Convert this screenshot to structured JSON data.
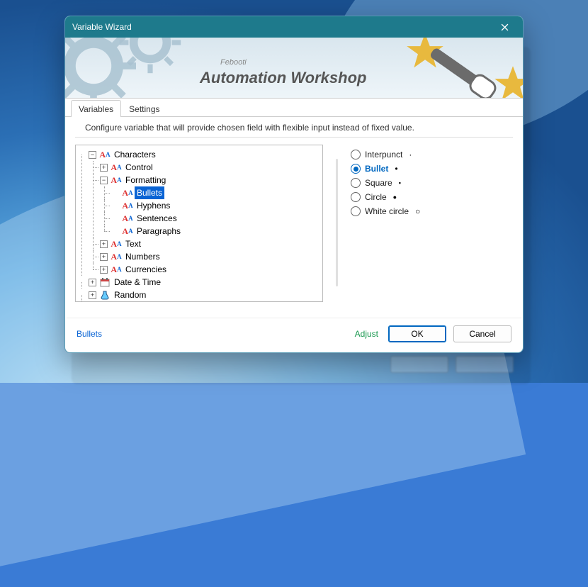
{
  "window": {
    "title": "Variable Wizard"
  },
  "banner": {
    "brand": "Febooti",
    "product": "Automation Workshop"
  },
  "tabs": {
    "variables": "Variables",
    "settings": "Settings",
    "active": "variables"
  },
  "instruction": "Configure variable that will provide chosen field with flexible input instead of fixed value.",
  "tree": {
    "characters": "Characters",
    "control": "Control",
    "formatting": "Formatting",
    "bullets": "Bullets",
    "hyphens": "Hyphens",
    "sentences": "Sentences",
    "paragraphs": "Paragraphs",
    "text": "Text",
    "numbers": "Numbers",
    "currencies": "Currencies",
    "datetime": "Date & Time",
    "random": "Random",
    "selected": "Bullets"
  },
  "radios": {
    "interpunct": {
      "label": "Interpunct",
      "sample": "·"
    },
    "bullet": {
      "label": "Bullet",
      "sample": "•"
    },
    "square": {
      "label": "Square",
      "sample": "▪"
    },
    "circle": {
      "label": "Circle",
      "sample": "●"
    },
    "whitecircle": {
      "label": "White circle",
      "sample": "○"
    },
    "selected": "bullet"
  },
  "footer": {
    "path": "Bullets",
    "adjust": "Adjust",
    "ok": "OK",
    "cancel": "Cancel"
  }
}
